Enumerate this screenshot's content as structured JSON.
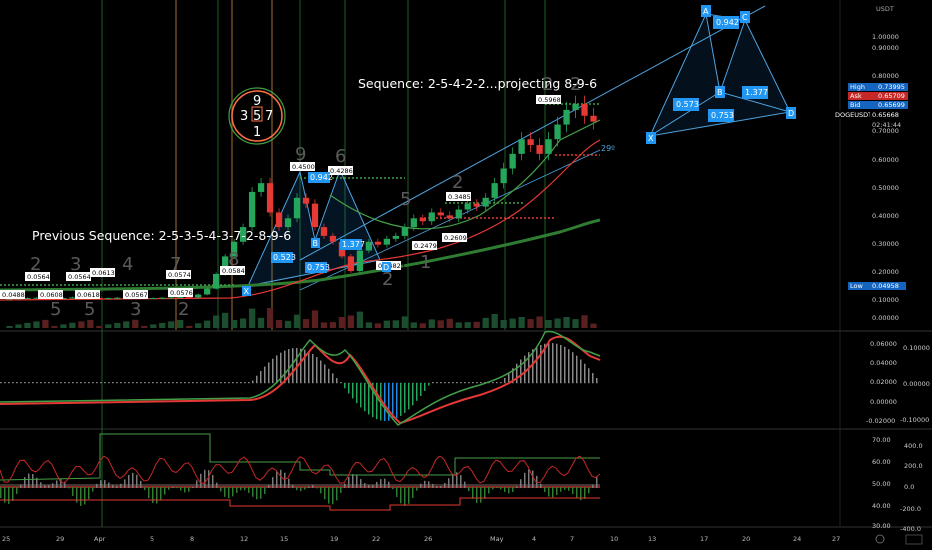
{
  "symbol": "DOGEUSDT",
  "currency": "USDT",
  "annotations": {
    "sequence_note": "Sequence: 2-5-4-2-2...projecting 8-9-6",
    "previous_note": "Previous Sequence: 2-5-3-5-4-3-7-2-8-9-6",
    "grid_top": "9",
    "grid_left": "3",
    "grid_mid": "5",
    "grid_right": "7",
    "grid_bottom": "1",
    "angle_label": "29º"
  },
  "harmonic_top": {
    "points": [
      "X",
      "A",
      "B",
      "C",
      "D"
    ],
    "ratios": [
      "0.573",
      "0.942",
      "0.753",
      "1.377"
    ]
  },
  "harmonic_main": {
    "points": [
      "X",
      "A",
      "B",
      "C",
      "D"
    ],
    "ratios": [
      "0.523",
      "0.942",
      "0.753",
      "1.377"
    ]
  },
  "price_axis": {
    "ticks": [
      "1.00000",
      "0.90000",
      "0.80000",
      "0.70000",
      "0.60000",
      "0.50000",
      "0.40000",
      "0.30000",
      "0.20000",
      "0.10000",
      "0.00000"
    ],
    "high_label": "High",
    "high_value": "0.73995",
    "ask_label": "Ask",
    "ask_value": "0.65709",
    "bid_label": "Bid",
    "bid_value": "0.65699",
    "last_value": "0.65668",
    "countdown": "02:41:44",
    "low_label": "Low",
    "low_value": "0.04958"
  },
  "osc1_axis": {
    "left_ticks": [
      "0.06000",
      "0.04000",
      "0.02000",
      "0.00000",
      "-0.02000"
    ],
    "right_ticks": [
      "0.10000",
      "0.00000",
      "-0.10000"
    ]
  },
  "osc2_axis": {
    "left_ticks": [
      "70.00",
      "60.00",
      "50.00",
      "40.00",
      "30.00"
    ],
    "right_ticks": [
      "400.0",
      "200.0",
      "0.0",
      "-200.0",
      "-400.0"
    ]
  },
  "time_axis": [
    "25",
    "29",
    "Apr",
    "5",
    "8",
    "12",
    "15",
    "19",
    "22",
    "26",
    "May",
    "4",
    "7",
    "10",
    "13",
    "17",
    "20",
    "24",
    "27"
  ],
  "wave_labels": [
    "2",
    "5",
    "3",
    "5",
    "4",
    "3",
    "7",
    "2",
    "8",
    "9",
    "6",
    "5",
    "2",
    "2",
    "2",
    "1",
    "2"
  ],
  "price_tags": [
    "0.04888",
    "0.05646",
    "0.05640",
    "0.06135",
    "0.06184",
    "0.06082",
    "0.05674",
    "0.05760",
    "0.05744",
    "0.05840",
    "0.45000",
    "0.42863",
    "0.14823",
    "0.24790",
    "0.26091",
    "0.34850",
    "0.59681"
  ],
  "chart_data": {
    "type": "candlestick",
    "ylim": [
      0,
      1.0
    ],
    "series": [
      {
        "name": "DOGEUSDT",
        "values": [
          0.056,
          0.057,
          0.058,
          0.059,
          0.058,
          0.057,
          0.058,
          0.06,
          0.059,
          0.058,
          0.057,
          0.058,
          0.059,
          0.06,
          0.058,
          0.057,
          0.058,
          0.059,
          0.06,
          0.061,
          0.06,
          0.07,
          0.09,
          0.14,
          0.2,
          0.25,
          0.3,
          0.42,
          0.45,
          0.35,
          0.3,
          0.33,
          0.4,
          0.38,
          0.3,
          0.27,
          0.25,
          0.2,
          0.15,
          0.22,
          0.25,
          0.24,
          0.26,
          0.27,
          0.3,
          0.33,
          0.32,
          0.35,
          0.34,
          0.33,
          0.36,
          0.38,
          0.37,
          0.4,
          0.45,
          0.5,
          0.55,
          0.6,
          0.58,
          0.55,
          0.6,
          0.65,
          0.7,
          0.72,
          0.68,
          0.66
        ]
      }
    ]
  }
}
